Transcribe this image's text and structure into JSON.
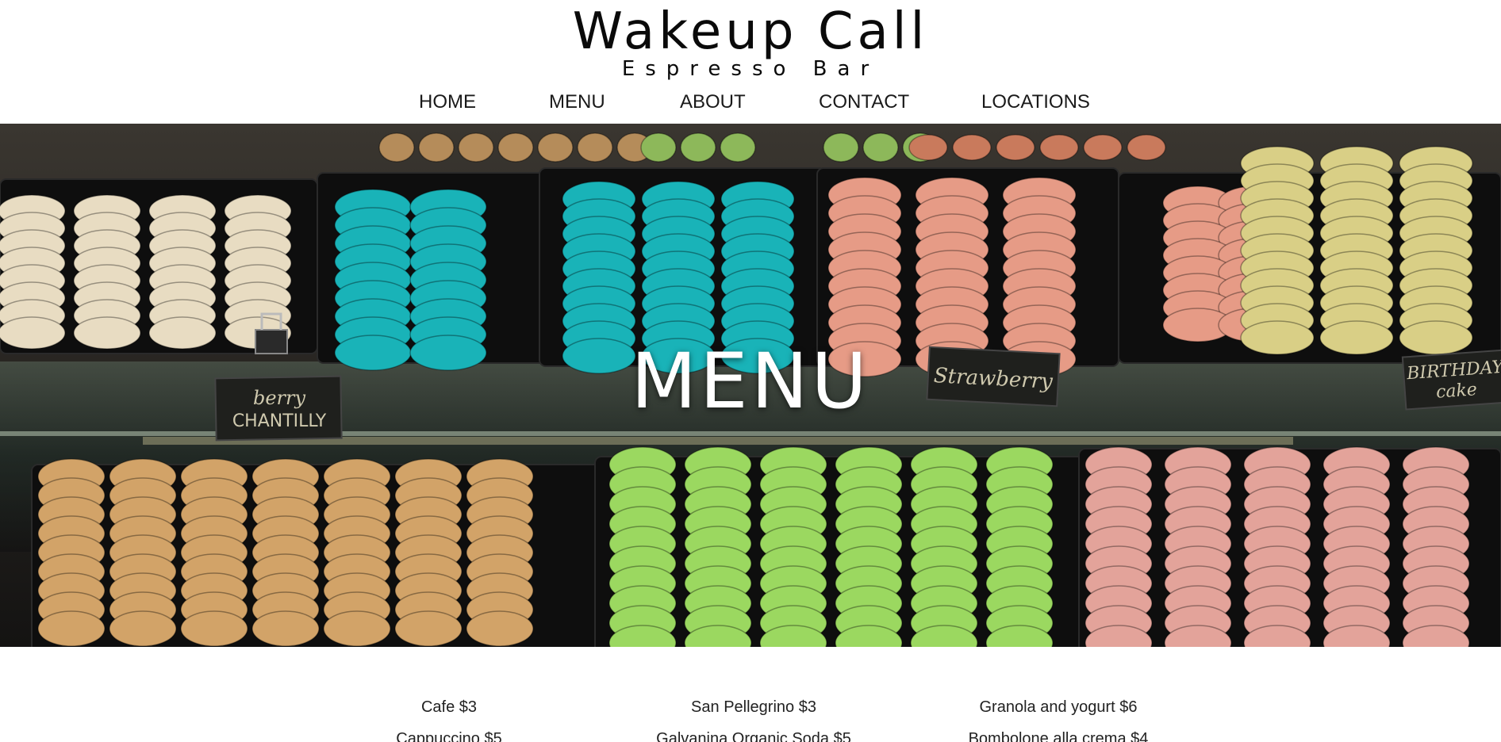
{
  "brand": {
    "title": "Wakeup Call",
    "subtitle": "Espresso Bar"
  },
  "nav": {
    "items": [
      {
        "label": "HOME"
      },
      {
        "label": "MENU"
      },
      {
        "label": "ABOUT"
      },
      {
        "label": "CONTACT"
      },
      {
        "label": "LOCATIONS"
      }
    ]
  },
  "hero": {
    "title": "MENU",
    "sign_labels": [
      "berry CHANTILLY",
      "Strawberry",
      "BIRTHDAY cake"
    ]
  },
  "menu": {
    "columns": [
      {
        "items": [
          "Cafe $3",
          "Cappuccino $5"
        ]
      },
      {
        "items": [
          "San Pellegrino $3",
          "Galvanina Organic Soda $5"
        ]
      },
      {
        "items": [
          "Granola and yogurt $6",
          "Bombolone alla crema $4"
        ]
      }
    ]
  },
  "colors": {
    "hero_bg": "#1b1a17",
    "macaron_teal": "#19b3b8",
    "macaron_cream": "#e8dcc2",
    "macaron_pink": "#e69b86",
    "macaron_yellow": "#d9cf86",
    "macaron_tan": "#d2a368",
    "macaron_green": "#9bd860",
    "macaron_rose": "#e3a39a"
  }
}
